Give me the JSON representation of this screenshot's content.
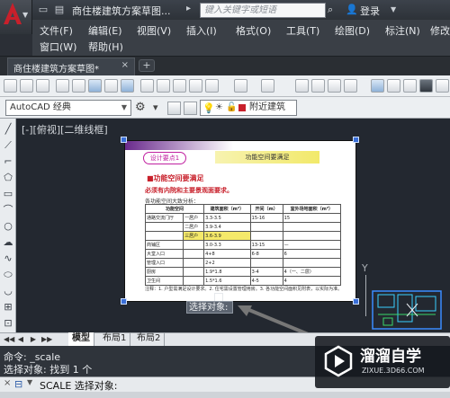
{
  "titlebar": {
    "title": "商住楼建筑方案草图...",
    "search_placeholder": "键入关键字或短语",
    "login_label": "登录"
  },
  "menu": {
    "items": [
      "文件(F)",
      "编辑(E)",
      "视图(V)",
      "插入(I)",
      "格式(O)",
      "工具(T)",
      "绘图(D)",
      "标注(N)",
      "修改",
      "窗口(W)",
      "帮助(H)"
    ]
  },
  "tabs": {
    "document": "商住楼建筑方案草图*",
    "close": "×",
    "new_tab": "+"
  },
  "toolbar2": {
    "workspace": "AutoCAD 经典",
    "layer_name": "附近建筑"
  },
  "canvas": {
    "viewport_label": "[-][俯视][二维线框]",
    "y_axis": "Y",
    "selection_tooltip": "选择对象:"
  },
  "document": {
    "badge": "设计要点1",
    "header": "功能空间要满足",
    "section_title": "■功能空间要满足",
    "subtitle": "必须有内院和主要景观面要求。",
    "table_caption": "各功能空间大致分析：",
    "table_headers": [
      "功能空间",
      "建筑面积（m²）",
      "开间（m）",
      "室外场地面积（m²）"
    ],
    "table_rows": [
      [
        "通路交流门厅",
        "一居户",
        "3.3-3.5",
        "15-16",
        "15"
      ],
      [
        "",
        "二居户",
        "3.9-3.4",
        "",
        ""
      ],
      [
        "",
        "三居户",
        "3.6-3.9",
        "",
        ""
      ],
      [
        "商铺区",
        "",
        "3.0-3.3",
        "13-15",
        "—"
      ],
      [
        "大堂入口",
        "",
        "4+8",
        "6-8",
        "6"
      ],
      [
        "管理入口",
        "",
        "2+2",
        "",
        ""
      ],
      [
        "厨房",
        "",
        "1.9*1.8",
        "3-4",
        "4（一、二层）"
      ],
      [
        "卫生间",
        "",
        "1.5*1.6",
        "4-5",
        "4"
      ]
    ],
    "notes": "注释：1. 户型需满足设计要求。2. 住宅需设置管理用房。3. 各功能空间面积见附表，以实际为准。"
  },
  "layout_tabs": {
    "nav": [
      "◀◀",
      "◀",
      "▶",
      "▶▶"
    ],
    "tabs": [
      "模型",
      "布局1",
      "布局2"
    ]
  },
  "command": {
    "history": [
      "命令:  _scale",
      "选择对象: 找到 1 个"
    ],
    "prompt": "SCALE 选择对象:"
  },
  "watermark": {
    "brand_cn": "溜溜自学",
    "brand_url": "ZIXUE.3D66.COM"
  },
  "colors": {
    "accent_red": "#c8202b",
    "canvas_bg": "#232830",
    "badge_magenta": "#c020a0",
    "header_yellow": "#f2e96a",
    "table_highlight": "#f5e96a"
  }
}
